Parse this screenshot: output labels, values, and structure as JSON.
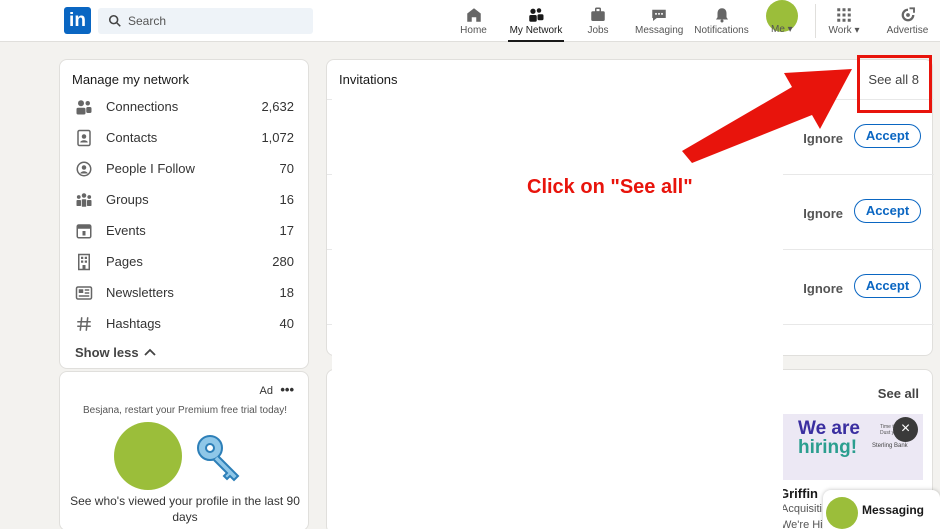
{
  "topbar": {
    "logo": "in",
    "search_placeholder": "Search",
    "nav": [
      {
        "label": "Home",
        "icon": "home-icon"
      },
      {
        "label": "My Network",
        "icon": "network-icon"
      },
      {
        "label": "Jobs",
        "icon": "briefcase-icon"
      },
      {
        "label": "Messaging",
        "icon": "messaging-icon"
      },
      {
        "label": "Notifications",
        "icon": "bell-icon"
      }
    ],
    "me_label": "Me",
    "work_label": "Work",
    "advertise_label": "Advertise"
  },
  "manage": {
    "title": "Manage my network",
    "items": [
      {
        "name": "Connections",
        "count": "2,632",
        "icon": "connections-icon"
      },
      {
        "name": "Contacts",
        "count": "1,072",
        "icon": "contacts-icon"
      },
      {
        "name": "People I Follow",
        "count": "70",
        "icon": "people-follow-icon"
      },
      {
        "name": "Groups",
        "count": "16",
        "icon": "groups-icon"
      },
      {
        "name": "Events",
        "count": "17",
        "icon": "events-icon"
      },
      {
        "name": "Pages",
        "count": "280",
        "icon": "pages-icon"
      },
      {
        "name": "Newsletters",
        "count": "18",
        "icon": "newsletters-icon"
      },
      {
        "name": "Hashtags",
        "count": "40",
        "icon": "hashtag-icon"
      }
    ],
    "show_less": "Show less"
  },
  "ad": {
    "label": "Ad",
    "dots": "•••",
    "promo": "Besjana, restart your Premium free trial today!",
    "text": "See who's viewed your profile in the last 90 days"
  },
  "invitations": {
    "title": "Invitations",
    "see_all": "See all 8",
    "rows": [
      {
        "ignore": "Ignore",
        "accept": "Accept"
      },
      {
        "ignore": "Ignore",
        "accept": "Accept"
      },
      {
        "ignore": "Ignore",
        "accept": "Accept"
      }
    ]
  },
  "annotation": {
    "callout": "Click on \"See all\""
  },
  "second": {
    "see_all": "See all",
    "banner_we_are": "We are",
    "banner_hiring": "hiring!",
    "banner_sub": "Time to join our Dust you",
    "bank": "Sterling Bank",
    "close": "×",
    "person_name": "Griffin",
    "person_sub": "Acquisiti",
    "person_sub2": "We're Hir"
  },
  "messaging": {
    "label": "Messaging"
  },
  "colors": {
    "brand": "#0a66c2",
    "annotation_red": "#e8140c",
    "avatar_green": "#9bbe3a"
  }
}
